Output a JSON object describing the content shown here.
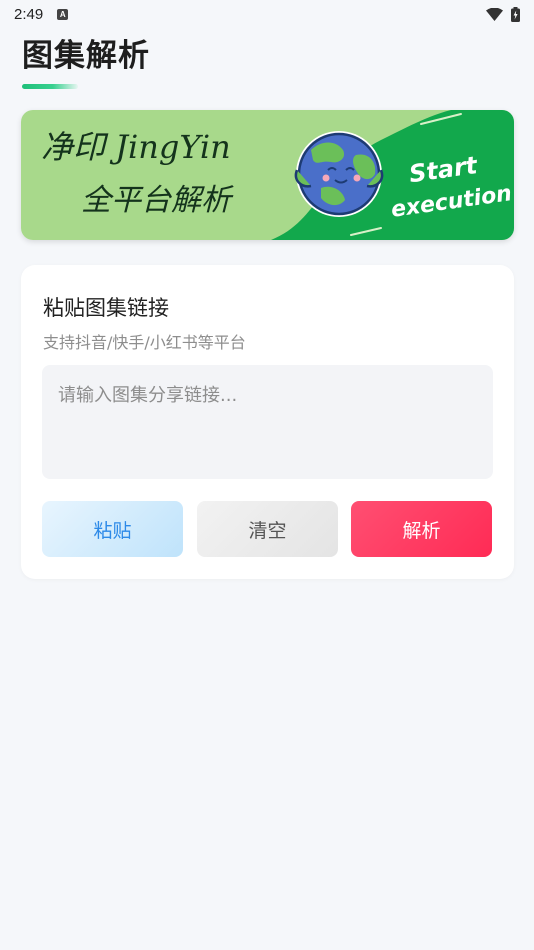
{
  "status_bar": {
    "time": "2:49",
    "notification_icon": "a-icon",
    "wifi_icon": "wifi-icon",
    "battery_icon": "battery-icon"
  },
  "header": {
    "title": "图集解析"
  },
  "banner": {
    "line1": "净印 JingYin",
    "line2": "全平台解析",
    "cta_line1": "Start",
    "cta_line2": "execution",
    "illustration": "earth-mascot"
  },
  "parse_card": {
    "title": "粘贴图集链接",
    "subtitle": "支持抖音/快手/小红书等平台",
    "input_placeholder": "请输入图集分享链接...",
    "input_value": "",
    "buttons": {
      "paste": "粘贴",
      "clear": "清空",
      "parse": "解析"
    }
  },
  "colors": {
    "accent_green": "#1fc07a",
    "banner_light_green": "#a6d98a",
    "banner_dark_green": "#0fa84b",
    "parse_button": "#ff2b55",
    "paste_button_text": "#2d8ae8"
  }
}
